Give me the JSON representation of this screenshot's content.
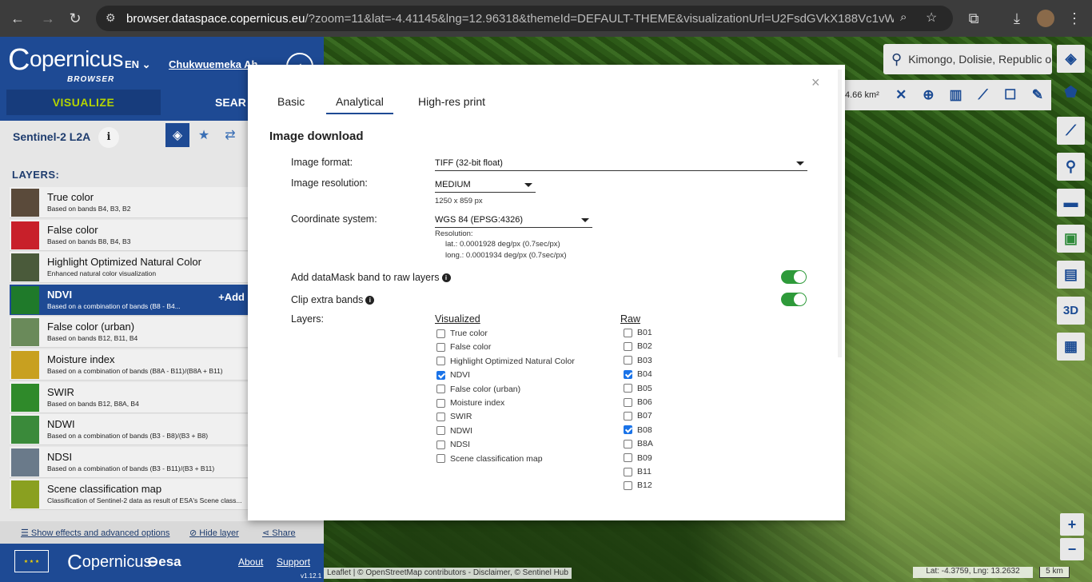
{
  "browser": {
    "url_host": "browser.dataspace.copernicus.eu",
    "url_rest": "/?zoom=11&lat=-4.41145&lng=12.96318&themeId=DEFAULT-THEME&visualizationUrl=U2FsdGVkX188Vc1vWvJuk%2Be..."
  },
  "header": {
    "logo_text": "opernicus",
    "logo_sub": "BROWSER",
    "lang": "EN",
    "user": "Chukwuemeka Ah...",
    "tab_visualize": "VISUALIZE",
    "tab_search": "SEAR"
  },
  "dataset": {
    "name": "Sentinel-2 L2A",
    "info": "i",
    "layers_label": "LAYERS:"
  },
  "layers": [
    {
      "title": "True color",
      "desc": "Based on bands B4, B3, B2",
      "color": "#5a4a3a"
    },
    {
      "title": "False color",
      "desc": "Based on bands B8, B4, B3",
      "color": "#c8202a"
    },
    {
      "title": "Highlight Optimized Natural Color",
      "desc": "Enhanced natural color visualization",
      "color": "#4a5a3a"
    },
    {
      "title": "NDVI",
      "desc": "Based on a combination of bands (B8 - B4...",
      "color": "#1f7a2a",
      "selected": true,
      "add": "+Add"
    },
    {
      "title": "False color (urban)",
      "desc": "Based on bands B12, B11, B4",
      "color": "#6a8a5a"
    },
    {
      "title": "Moisture index",
      "desc": "Based on a combination of bands (B8A - B11)/(B8A + B11)",
      "color": "#c8a020"
    },
    {
      "title": "SWIR",
      "desc": "Based on bands B12, B8A, B4",
      "color": "#2f8a2a"
    },
    {
      "title": "NDWI",
      "desc": "Based on a combination of bands (B3 - B8)/(B3 + B8)",
      "color": "#3a8a3a"
    },
    {
      "title": "NDSI",
      "desc": "Based on a combination of bands (B3 - B11)/(B3 + B11)",
      "color": "#6a7a8a"
    },
    {
      "title": "Scene classification map",
      "desc": "Classification of Sentinel-2 data as result of ESA's Scene class...",
      "color": "#8aa020"
    }
  ],
  "panel_links": {
    "effects": "Show effects and advanced options",
    "hide": "Hide layer",
    "share": "Share"
  },
  "footer": {
    "logo": "opernicus",
    "esa": "esa",
    "about": "About",
    "support": "Support",
    "version": "v1.12.1"
  },
  "map": {
    "search_text": "Kimongo, Dolisie, Republic o",
    "area": "4.66 km²",
    "attribution": "Leaflet | © OpenStreetMap contributors - Disclaimer, © Sentinel Hub",
    "latlng": "Lat: -4.3759, Lng: 13.2632",
    "scale": "5 km",
    "btn_3d": "3D"
  },
  "modal": {
    "tabs": [
      "Basic",
      "Analytical",
      "High-res print"
    ],
    "close": "×",
    "section_title": "Image download",
    "image_format_label": "Image format:",
    "image_format_value": "TIFF (32-bit float)",
    "image_resolution_label": "Image resolution:",
    "image_resolution_value": "MEDIUM",
    "image_size": "1250 x 859 px",
    "coord_label": "Coordinate system:",
    "coord_value": "WGS 84 (EPSG:4326)",
    "resolution_title": "Resolution:",
    "resolution_lat": "lat.: 0.0001928 deg/px (0.7sec/px)",
    "resolution_long": "long.: 0.0001934 deg/px (0.7sec/px)",
    "datamask_label": "Add dataMask band to raw layers",
    "clip_label": "Clip extra bands",
    "layers_label": "Layers:",
    "visualized_head": "Visualized",
    "raw_head": "Raw",
    "visualized": [
      {
        "label": "True color",
        "checked": false
      },
      {
        "label": "False color",
        "checked": false
      },
      {
        "label": "Highlight Optimized Natural Color",
        "checked": false
      },
      {
        "label": "NDVI",
        "checked": true
      },
      {
        "label": "False color (urban)",
        "checked": false
      },
      {
        "label": "Moisture index",
        "checked": false
      },
      {
        "label": "SWIR",
        "checked": false
      },
      {
        "label": "NDWI",
        "checked": false
      },
      {
        "label": "NDSI",
        "checked": false
      },
      {
        "label": "Scene classification map",
        "checked": false
      }
    ],
    "raw": [
      {
        "label": "B01",
        "checked": false
      },
      {
        "label": "B02",
        "checked": false
      },
      {
        "label": "B03",
        "checked": false
      },
      {
        "label": "B04",
        "checked": true
      },
      {
        "label": "B05",
        "checked": false
      },
      {
        "label": "B06",
        "checked": false
      },
      {
        "label": "B07",
        "checked": false
      },
      {
        "label": "B08",
        "checked": true
      },
      {
        "label": "B8A",
        "checked": false
      },
      {
        "label": "B09",
        "checked": false
      },
      {
        "label": "B11",
        "checked": false
      },
      {
        "label": "B12",
        "checked": false
      }
    ]
  }
}
